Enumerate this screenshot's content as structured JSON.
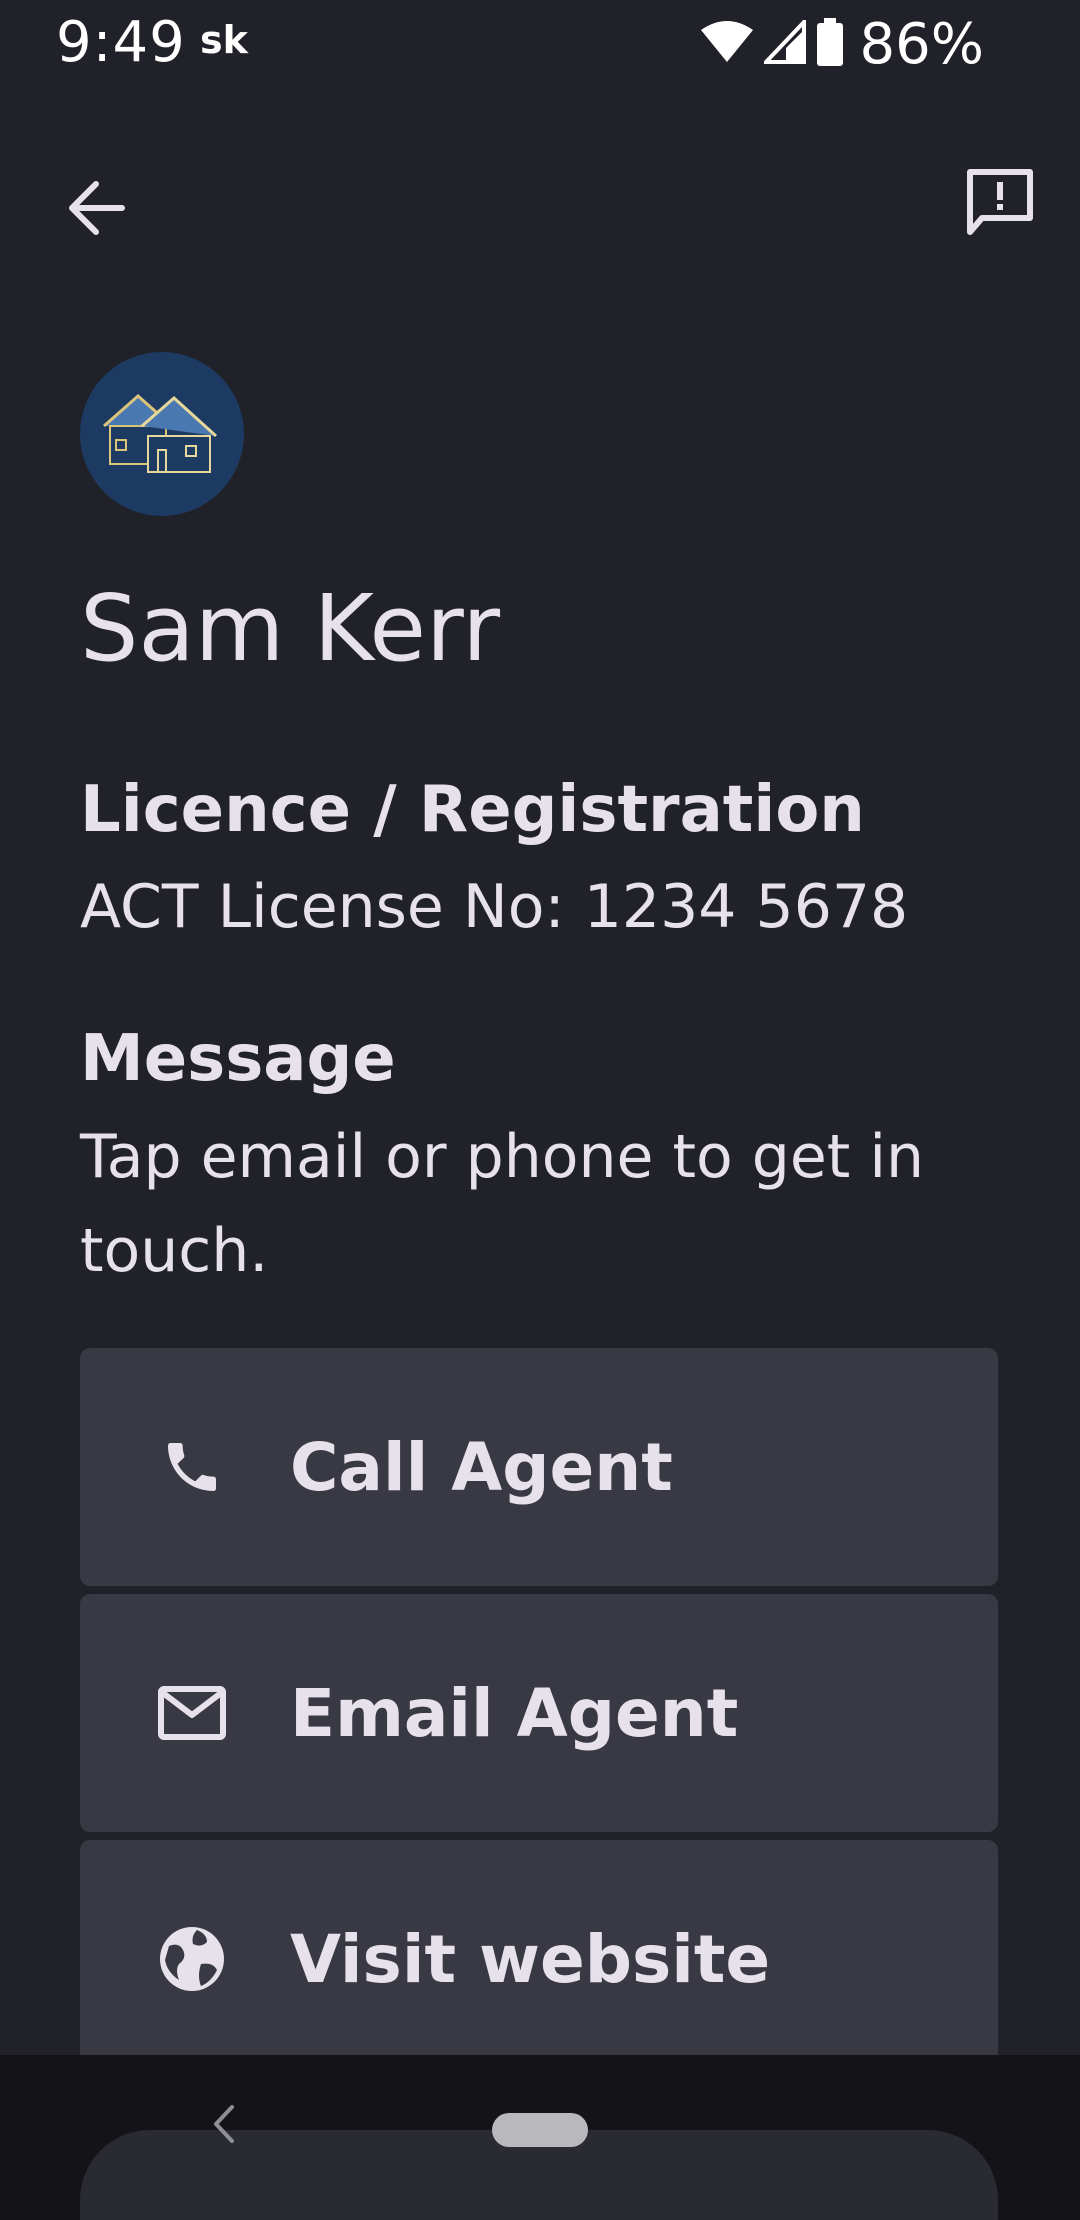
{
  "status_bar": {
    "time": "9:49",
    "carrier_badge": "sk",
    "battery_percent": "86%",
    "icons": [
      "wifi-icon",
      "cell-signal-icon",
      "battery-icon"
    ]
  },
  "app_bar": {
    "back_icon": "arrow-back-icon",
    "feedback_icon": "feedback-icon"
  },
  "agent": {
    "avatar_icon": "houses-logo-icon",
    "name": "Sam Kerr"
  },
  "licence": {
    "label": "Licence / Registration",
    "value": "ACT License No: 1234 5678"
  },
  "message": {
    "label": "Message",
    "value": "Tap email or phone to get in touch."
  },
  "actions": [
    {
      "label": "Call Agent",
      "icon": "phone-icon"
    },
    {
      "label": "Email Agent",
      "icon": "mail-icon"
    },
    {
      "label": "Visit website",
      "icon": "globe-icon"
    }
  ],
  "colors": {
    "background": "#202129",
    "button_bg": "#393943",
    "text": "#e6e1ea",
    "avatar_bg": "#1d3a63"
  }
}
